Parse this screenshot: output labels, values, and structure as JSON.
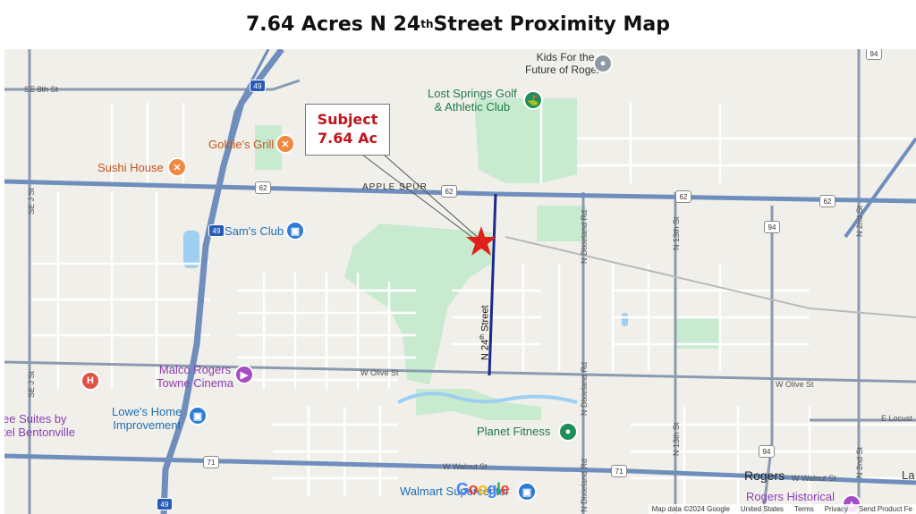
{
  "title": {
    "prefix": "7.64 Acres N 24",
    "superscript": "th",
    "suffix": " Street Proximity Map"
  },
  "callout": {
    "line1": "Subject",
    "line2": "7.64 Ac"
  },
  "subject_street": {
    "prefix": "N 24",
    "superscript": "th",
    "suffix": " Street"
  },
  "pois": {
    "kids_for_future": "Kids For the\nFuture of Rogers",
    "lost_springs": "Lost Springs Golf\n& Athletic Club",
    "goldies_grill": "Goldie's Grill",
    "sushi_house": "Sushi House",
    "sams_club": "Sam's Club",
    "malco": "Malco Rogers\nTowne Cinema",
    "lowes": "Lowe's Home\nImprovement",
    "suites": "ee Suites by\ntel Bentonville",
    "planet_fitness": "Planet Fitness",
    "walmart": "Walmart Supercenter",
    "rogers": "Rogers",
    "rogers_historical": "Rogers Historical",
    "la": "La"
  },
  "roads": {
    "se_8th": "SE 8th St",
    "apple_spur": "APPLE SPUR",
    "w_olive_1": "W Olive St",
    "w_olive_2": "W Olive St",
    "w_walnut_1": "W Walnut St",
    "w_walnut_2": "W Walnut St",
    "e_locust": "E Locust",
    "se_j_1": "SE J St",
    "se_j_2": "SE J St",
    "n_dixieland_1": "N Dixieland Rd",
    "n_dixieland_2": "N Dixieland Rd",
    "n_dixieland_3": "N Dixieland Rd",
    "n_13th_1": "N 13th St",
    "n_13th_2": "N 13th St",
    "n_2nd_1": "N 2nd St",
    "n_2nd_2": "N 2nd St"
  },
  "shields": {
    "i49_top": "49",
    "i49_mid": "49",
    "i49_bottom": "49",
    "hwy62_a": "62",
    "hwy62_b": "62",
    "hwy62_c": "62",
    "hwy62_d": "62",
    "hwy94_a": "94",
    "hwy94_b": "94",
    "hwy94_c": "94",
    "bus71_a": "71",
    "bus71_b": "71"
  },
  "google_logo": {
    "g1": "G",
    "o1": "o",
    "o2": "o",
    "g2": "g",
    "l": "l",
    "e": "e"
  },
  "attribution": {
    "map_data": "Map data ©2024 Google",
    "country": "United States",
    "terms": "Terms",
    "privacy": "Privacy",
    "feedback": "Send Product Fe"
  },
  "colors": {
    "land": "#f1efe9",
    "park": "#c8ebd0",
    "water": "#9fcff0",
    "highway": "#6f8ebd",
    "arterial": "#8a9bb0",
    "subject_street": "#1a2b8c",
    "subject_star": "#e0201b"
  }
}
